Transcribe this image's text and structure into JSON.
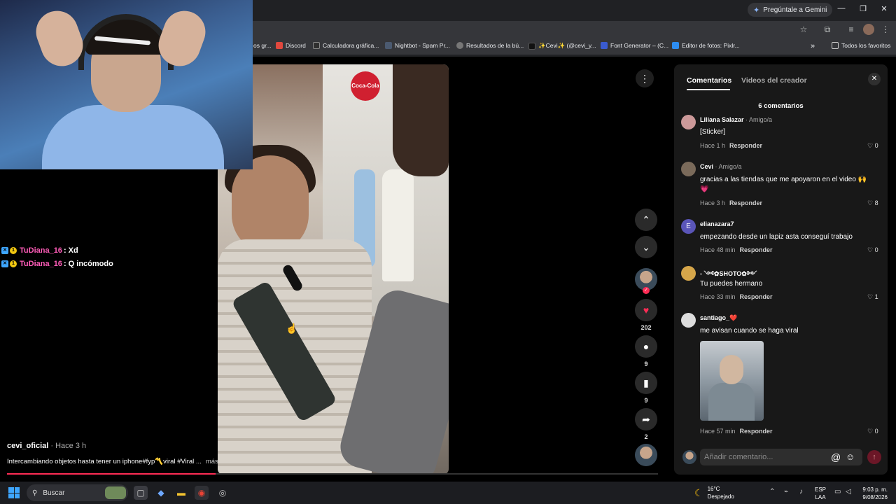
{
  "browser": {
    "gemini_label": "Pregúntale a Gemini",
    "bookmarks": [
      {
        "label": "os gr...",
        "color": "#555"
      },
      {
        "label": "Discord",
        "color": "#e0483e"
      },
      {
        "label": "Calculadora gráfica...",
        "color": "#2f2f2f"
      },
      {
        "label": "Nightbot - Spam Pr...",
        "color": "#4b5a70"
      },
      {
        "label": "Resultados de la bú...",
        "color": "#777"
      },
      {
        "label": "✨Cevi✨ (@cevi_y...",
        "color": "#111"
      },
      {
        "label": "Font Generator – (C...",
        "color": "#3a5bd0"
      },
      {
        "label": "Editor de fotos: Pixlr...",
        "color": "#2d8cf0"
      }
    ],
    "bookmarks_more": "»",
    "all_favorites": "Todos los favoritos"
  },
  "stream_chat": [
    {
      "user": "TuDiana_16",
      "text": ": Xd"
    },
    {
      "user": "TuDiana_16",
      "text": ": Q incómodo"
    }
  ],
  "video": {
    "creator": "cevi_oficial",
    "time_ago": " · Hace 3 h",
    "description": "Intercambiando objetos hasta tener un iphone#fyp〽️viral #Viral ...",
    "more_label": "más",
    "store_sign": "Coca-Cola",
    "progress": 0.32
  },
  "rail": {
    "likes": "202",
    "comments": "9",
    "saves": "9",
    "shares": "2"
  },
  "panel": {
    "tab_comments": "Comentarios",
    "tab_creator": "Videos del creador",
    "count": "6 comentarios",
    "comments": [
      {
        "user": "Liliana Salazar",
        "tag": " · Amigo/a",
        "text": "[Sticker]",
        "time": "Hace 1 h",
        "reply": "Responder",
        "likes": "0",
        "avatar": "#c99"
      },
      {
        "user": "Cevi",
        "tag": " · Amigo/a",
        "text": "gracias a las tiendas que me apoyaron en el video 🙌",
        "text2": "💗",
        "time": "Hace 3 h",
        "reply": "Responder",
        "likes": "8",
        "avatar": "#7a6a5a"
      },
      {
        "user": "elianazara7",
        "tag": "",
        "text": "empezando desde un lapiz asta conseguí trabajo",
        "time": "Hace 48 min",
        "reply": "Responder",
        "likes": "0",
        "avatar": "#5a55b8",
        "initial": "E"
      },
      {
        "user": "- ༺✿SHOTO✿༻",
        "tag": "",
        "text": "Tu puedes hermano",
        "time": "Hace 33 min",
        "reply": "Responder",
        "likes": "1",
        "avatar": "#d6a64a"
      },
      {
        "user": "santiago_❤️",
        "tag": "",
        "text": "me avisan cuando se haga viral",
        "time": "Hace 57 min",
        "reply": "Responder",
        "likes": "0",
        "avatar": "#ddd"
      }
    ],
    "input_placeholder": "Añadir comentario..."
  },
  "taskbar": {
    "search": "Buscar",
    "temp": "16°C",
    "weather": "Despejado",
    "lang1": "ESP",
    "lang2": "LAA",
    "time": "9:03 p. m.",
    "date": "9/08/2026"
  }
}
